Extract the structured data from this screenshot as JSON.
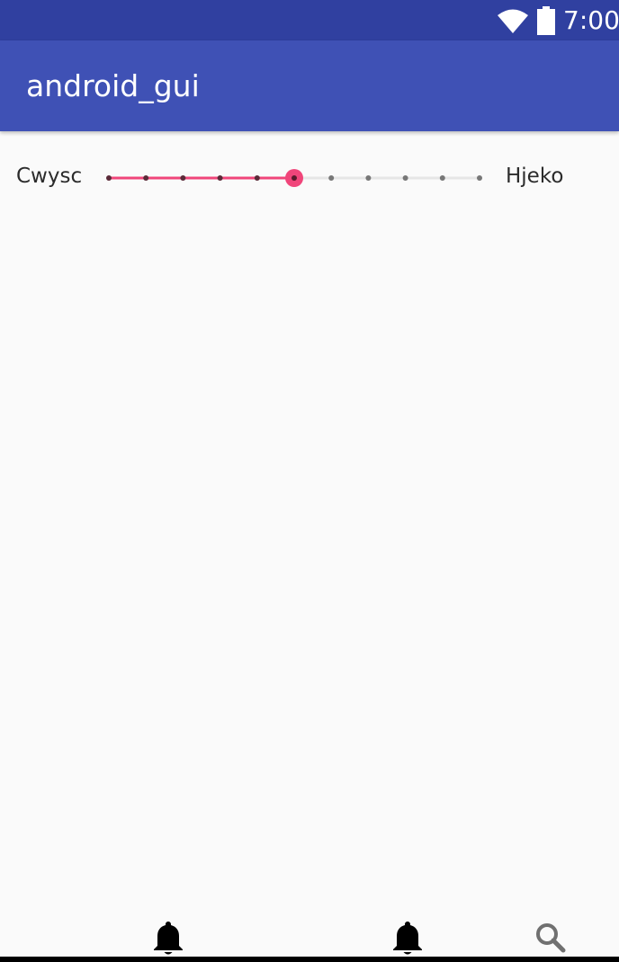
{
  "status_bar": {
    "time": "7:00",
    "icons": [
      "wifi-icon",
      "battery-icon"
    ],
    "background": "#3040A0"
  },
  "app_bar": {
    "title": "android_gui",
    "background": "#3F51B5"
  },
  "slider": {
    "label_left": "Cwysc",
    "label_right": "Hjeko",
    "min": 0,
    "max": 10,
    "value": 5,
    "accent_color": "#F0457A"
  },
  "bottom_nav": {
    "icons": [
      "bell-icon",
      "bell-icon",
      "search-icon"
    ]
  }
}
